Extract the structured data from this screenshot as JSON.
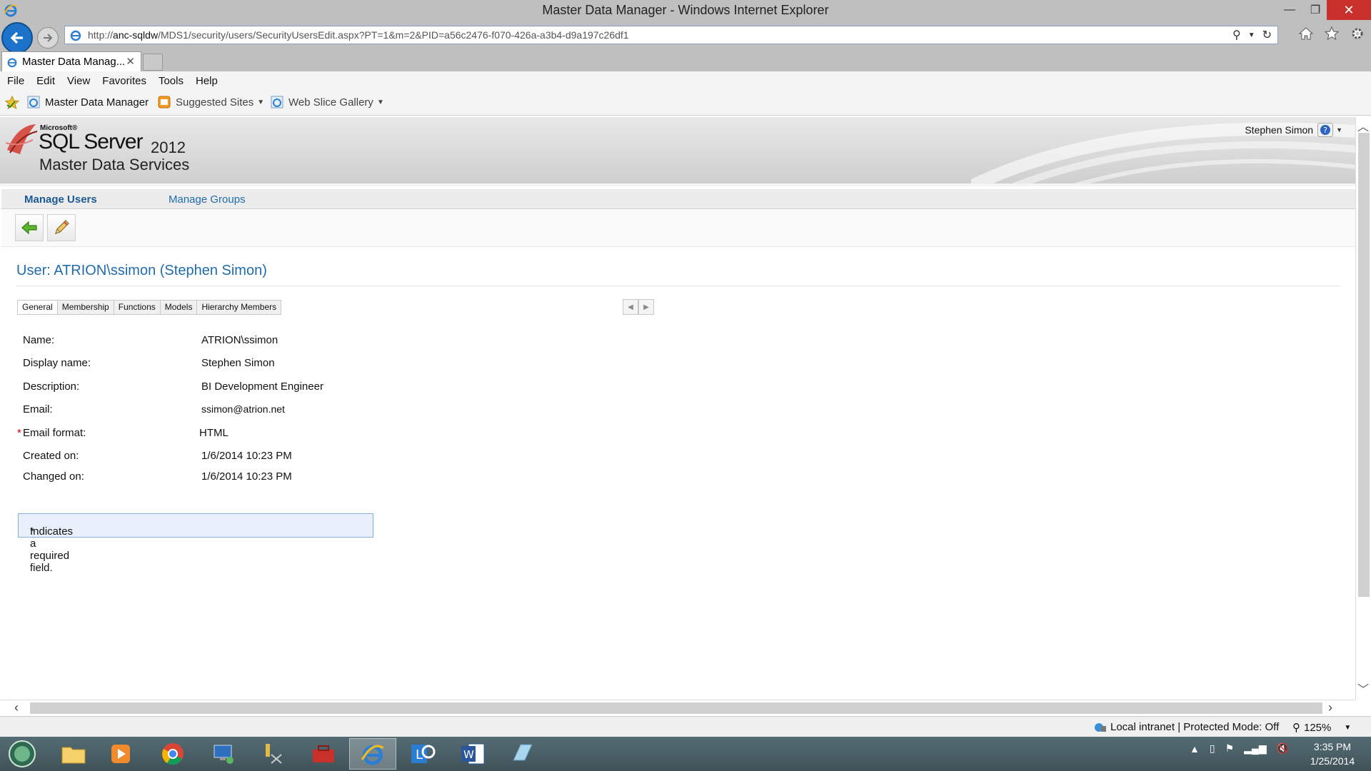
{
  "window": {
    "title": "Master Data Manager - Windows Internet Explorer",
    "minimize": "—",
    "maximize": "❐",
    "close": "✕"
  },
  "browser": {
    "url_prefix": "http://",
    "url_host": "anc-sqldw",
    "url_path": "/MDS1/security/users/SecurityUsersEdit.aspx?PT=1&m=2&PID=a56c2476-f070-426a-a3b4-d9a197c26df1",
    "tab_title": "Master Data Manag...",
    "tab_close": "✕"
  },
  "menu": [
    "File",
    "Edit",
    "View",
    "Favorites",
    "Tools",
    "Help"
  ],
  "favorites": {
    "item1": "Master Data Manager",
    "item2": "Suggested Sites",
    "item3": "Web Slice Gallery"
  },
  "header": {
    "microsoft": "Microsoft®",
    "product": "SQL Server",
    "version": "2012",
    "subtitle": "Master Data Services",
    "user": "Stephen Simon"
  },
  "nav": {
    "manage_users": "Manage Users",
    "manage_groups": "Manage Groups"
  },
  "page": {
    "title": "User: ATRION\\ssimon (Stephen Simon)",
    "tabs": [
      "General",
      "Membership",
      "Functions",
      "Models",
      "Hierarchy Members"
    ],
    "fields": [
      {
        "label": "Name:",
        "value": "ATRION\\ssimon"
      },
      {
        "label": "Display name:",
        "value": "Stephen Simon"
      },
      {
        "label": "Description:",
        "value": "BI Development Engineer"
      },
      {
        "label": "Email:",
        "value": "ssimon@atrion.net"
      },
      {
        "label": "Email format:",
        "value": "HTML",
        "required": true
      },
      {
        "label": "Created on:",
        "value": "1/6/2014 10:23 PM"
      },
      {
        "label": "Changed on:",
        "value": "1/6/2014 10:23 PM"
      }
    ],
    "required_mark": "*",
    "required_note": "Indicates a required field."
  },
  "status": {
    "zone": "Local intranet | Protected Mode: Off",
    "zoom": "125%"
  },
  "taskbar": {
    "time": "3:35 PM",
    "date": "1/25/2014"
  },
  "colors": {
    "link": "#1f6cad",
    "required": "#cc0000",
    "note_bg": "#e8f1fb",
    "close_button": "#c9302c"
  }
}
